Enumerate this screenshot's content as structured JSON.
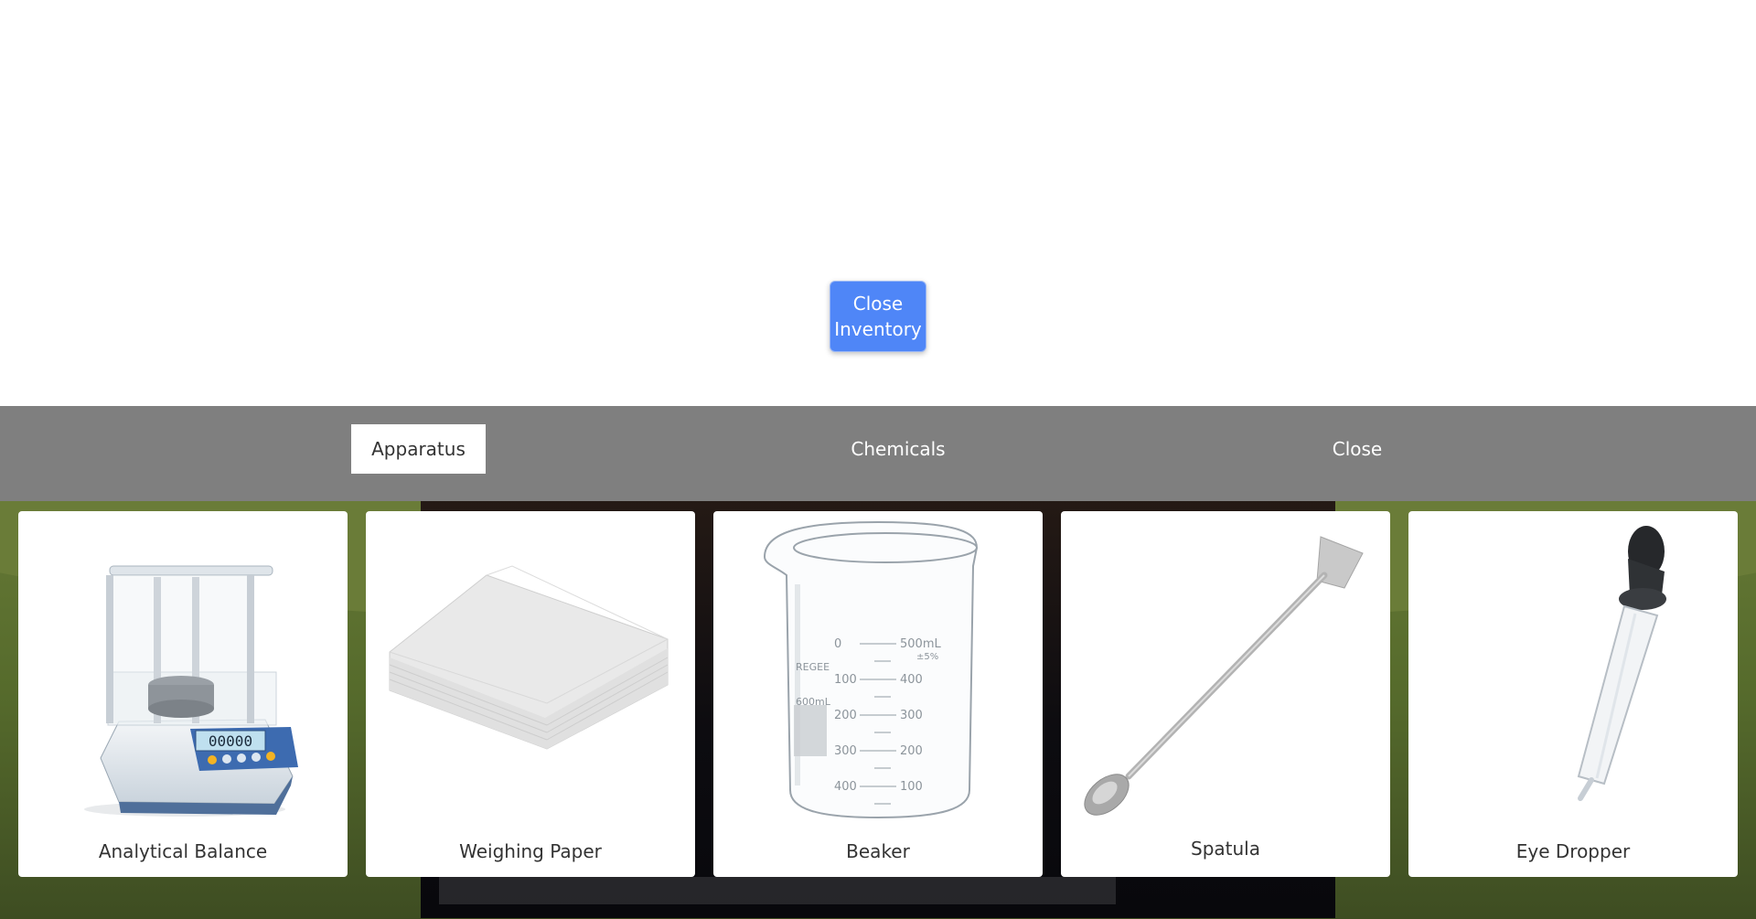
{
  "top": {
    "close_inventory_label": "Close Inventory"
  },
  "tabs": [
    {
      "label": "Apparatus",
      "active": true
    },
    {
      "label": "Chemicals",
      "active": false
    },
    {
      "label": "Close",
      "active": false
    }
  ],
  "items": [
    {
      "label": "Analytical Balance",
      "icon": "analytical-balance-icon"
    },
    {
      "label": "Weighing Paper",
      "icon": "weighing-paper-icon"
    },
    {
      "label": "Beaker",
      "icon": "beaker-icon",
      "markings": {
        "left": [
          "0",
          "100",
          "200",
          "300",
          "400"
        ],
        "right": [
          "500mL",
          "400",
          "300",
          "200",
          "100"
        ],
        "tolerance": "±5%",
        "brand": "REGEE",
        "capacity": "600mL"
      }
    },
    {
      "label": "Spatula",
      "icon": "spatula-icon"
    },
    {
      "label": "Eye Dropper",
      "icon": "eye-dropper-icon"
    }
  ],
  "balance_display": "00000",
  "colors": {
    "accent": "#4f86f7",
    "header": "#7f7f7f",
    "card": "#ffffff"
  }
}
